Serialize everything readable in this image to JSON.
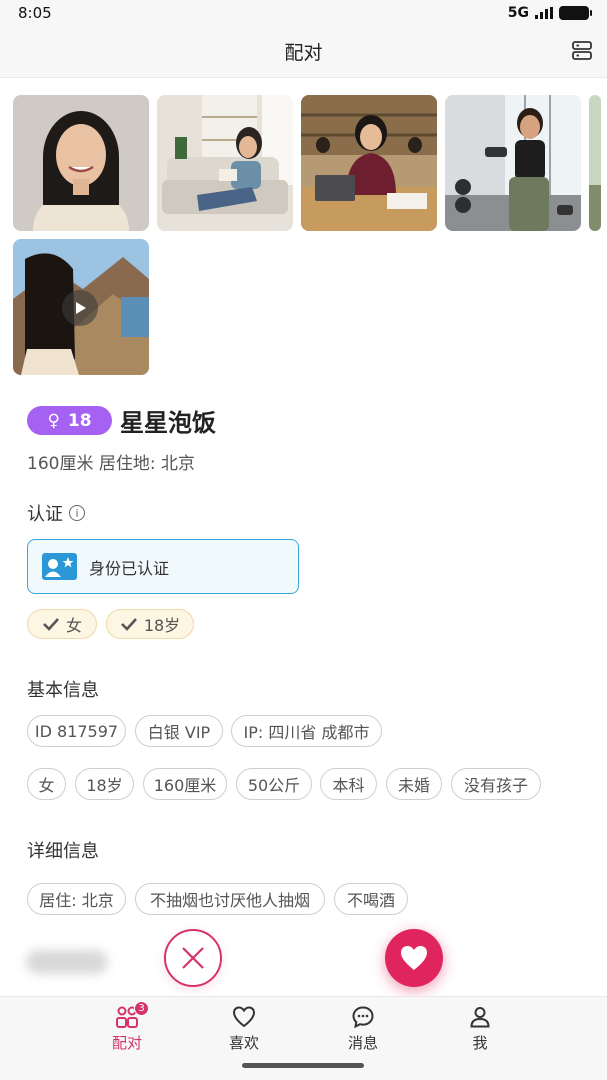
{
  "status_bar": {
    "time": "8:05",
    "network": "5G"
  },
  "header": {
    "title": "配对",
    "menu_icon": "server-stack-icon"
  },
  "photos": [
    {
      "name": "portrait-photo"
    },
    {
      "name": "sofa-reading-photo"
    },
    {
      "name": "library-study-photo"
    },
    {
      "name": "gym-workout-photo"
    },
    {
      "name": "mountain-video-thumb",
      "is_video": true
    }
  ],
  "profile": {
    "gender_symbol": "♀",
    "age": "18",
    "nickname": "星星泡饭",
    "subinfo": "160厘米  居住地: 北京"
  },
  "verification": {
    "title": "认证",
    "info_icon": "i",
    "card_label": "身份已认证",
    "tags": [
      "女",
      "18岁"
    ]
  },
  "basic_info": {
    "title": "基本信息",
    "row1": [
      "ID 817597",
      "白银 VIP",
      "IP: 四川省 成都市"
    ],
    "row2": [
      "女",
      "18岁",
      "160厘米",
      "50公斤",
      "本科",
      "未婚",
      "没有孩子"
    ]
  },
  "detail_info": {
    "title": "详细信息",
    "row1": [
      "居住: 北京",
      "不抽烟也讨厌他人抽烟",
      "不喝酒"
    ]
  },
  "nav": {
    "items": [
      {
        "label": "配对",
        "badge": "3",
        "active": true
      },
      {
        "label": "喜欢"
      },
      {
        "label": "消息"
      },
      {
        "label": "我"
      }
    ]
  },
  "colors": {
    "accent": "#d6336c",
    "like": "#e0245e",
    "gender": "#a561f2",
    "verify": "#2a98d6"
  }
}
